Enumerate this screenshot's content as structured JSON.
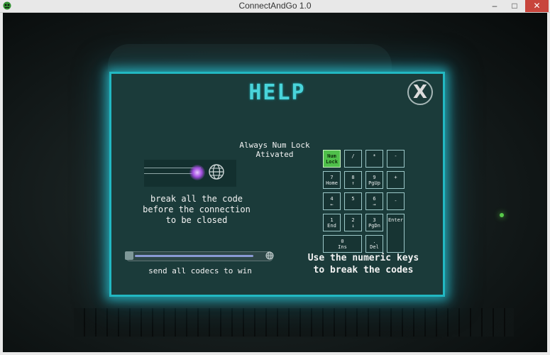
{
  "window": {
    "title": "ConnectAndGo 1.0",
    "minimize_label": "–",
    "maximize_label": "□",
    "close_label": "✕"
  },
  "help": {
    "title": "HELP",
    "close_label": "X",
    "numlock_note": "Always Num Lock\nAtivated",
    "break_text": "break all the code\nbefore the connection\nto be closed",
    "codecs_text": "send all codecs to win",
    "usekeys_text": "Use the numeric keys\nto break the codes",
    "progress_fraction": 0.92
  },
  "numpad": {
    "keys": [
      {
        "label": "Num\nLock",
        "active": true
      },
      {
        "label": "/"
      },
      {
        "label": "*"
      },
      {
        "label": "-"
      },
      {
        "label": "7\nHome"
      },
      {
        "label": "8\n↑"
      },
      {
        "label": "9\nPgUp"
      },
      {
        "label": "+"
      },
      {
        "label": "4\n←"
      },
      {
        "label": "5"
      },
      {
        "label": "6\n→"
      },
      {
        "label": "1\nEnd"
      },
      {
        "label": "2\n↓"
      },
      {
        "label": "3\nPgDn"
      },
      {
        "label": "Enter"
      },
      {
        "label": "0\nIns"
      },
      {
        "label": ".\nDel"
      }
    ],
    "extra_key": "-"
  },
  "colors": {
    "accent": "#22b8c2",
    "title": "#49d4da",
    "panel": "#1b3b3a",
    "active_key": "#4fbf4a",
    "window_close": "#c8453c"
  },
  "icons": [
    "app-icon",
    "close-icon",
    "spark-icon",
    "globe-icon",
    "computer-icon"
  ]
}
